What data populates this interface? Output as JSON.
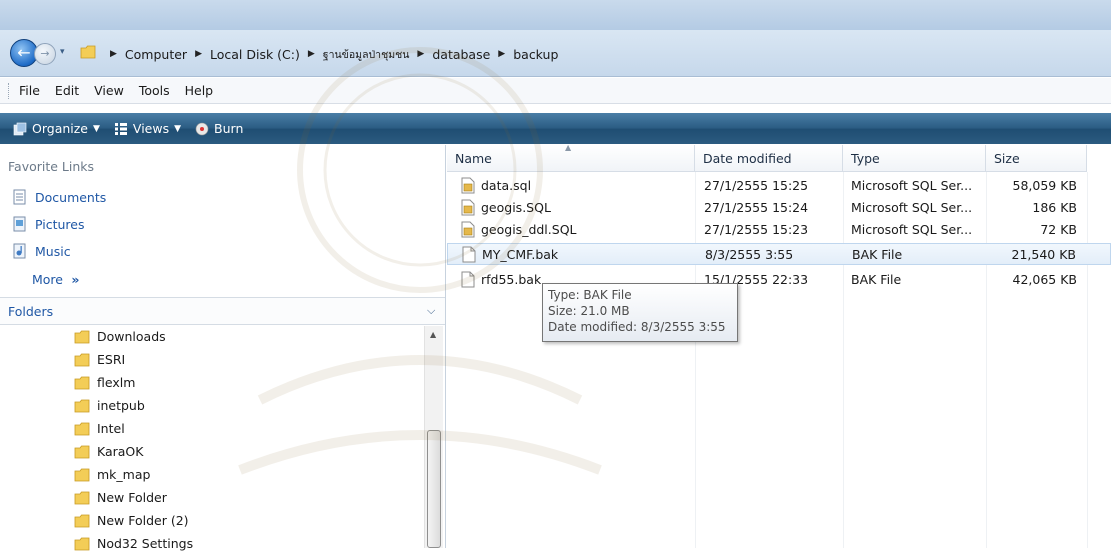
{
  "address": {
    "crumbs": [
      "Computer",
      "Local Disk (C:)",
      "ฐานข้อมูลป่าชุมชน",
      "database",
      "backup"
    ]
  },
  "menu": [
    "File",
    "Edit",
    "View",
    "Tools",
    "Help"
  ],
  "toolbar": {
    "organize": "Organize",
    "views": "Views",
    "burn": "Burn"
  },
  "favorites": {
    "title": "Favorite Links",
    "items": [
      "Documents",
      "Pictures",
      "Music"
    ],
    "more": "More"
  },
  "folders": {
    "title": "Folders",
    "items": [
      "Downloads",
      "ESRI",
      "flexlm",
      "inetpub",
      "Intel",
      "KaraOK",
      "mk_map",
      "New Folder",
      "New Folder (2)",
      "Nod32 Settings"
    ]
  },
  "columns": [
    "Name",
    "Date modified",
    "Type",
    "Size"
  ],
  "files": [
    {
      "name": "data.sql",
      "date": "27/1/2555 15:25",
      "type": "Microsoft SQL Ser...",
      "size": "58,059 KB",
      "icon": "sql-file-icon"
    },
    {
      "name": "geogis.SQL",
      "date": "27/1/2555 15:24",
      "type": "Microsoft SQL Ser...",
      "size": "186 KB",
      "icon": "sql-file-icon"
    },
    {
      "name": "geogis_ddl.SQL",
      "date": "27/1/2555 15:23",
      "type": "Microsoft SQL Ser...",
      "size": "72 KB",
      "icon": "sql-file-icon"
    },
    {
      "name": "MY_CMF.bak",
      "date": "8/3/2555 3:55",
      "type": "BAK File",
      "size": "21,540 KB",
      "icon": "blank-file-icon"
    },
    {
      "name": "rfd55.bak",
      "date": "15/1/2555 22:33",
      "type": "BAK File",
      "size": "42,065 KB",
      "icon": "blank-file-icon"
    }
  ],
  "tooltip": {
    "type": "Type: BAK File",
    "size": "Size: 21.0 MB",
    "modified": "Date modified: 8/3/2555 3:55"
  },
  "colors": {
    "link": "#1f57a5",
    "toolbar": "#2a5b82",
    "folder": "#e9b93a"
  }
}
